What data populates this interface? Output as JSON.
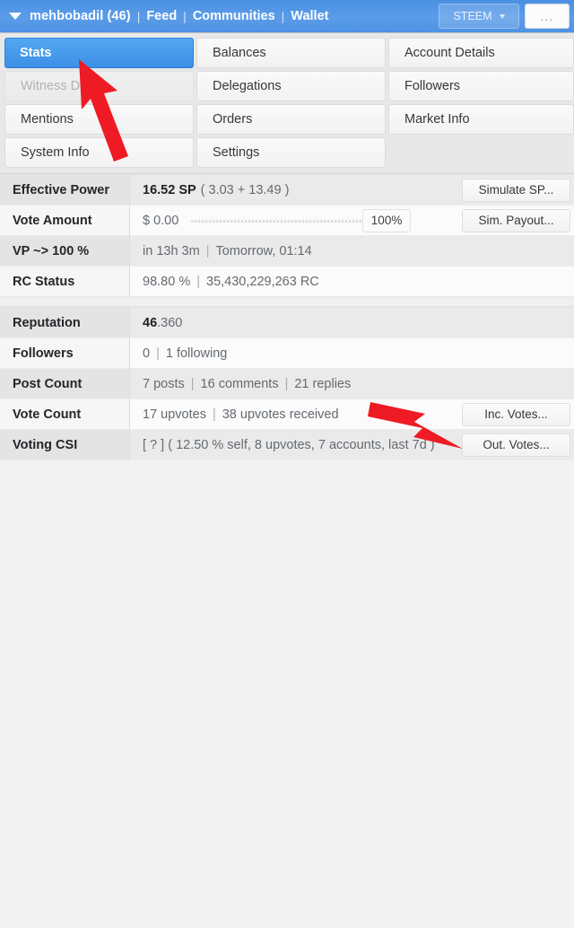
{
  "header": {
    "caret_icon": "caret-down-icon",
    "account": "mehbobadil (46)",
    "sep": "|",
    "links": [
      "Feed",
      "Communities",
      "Wallet"
    ],
    "token_selector": "STEEM",
    "token_caret_icon": "chevron-down-icon",
    "overflow_label": "...",
    "bg_color": "#4a90e2"
  },
  "nav": {
    "buttons": [
      {
        "label": "Stats",
        "state": "active"
      },
      {
        "label": "Balances",
        "state": "normal"
      },
      {
        "label": "Account Details",
        "state": "normal"
      },
      {
        "label": "Witness Detail",
        "state": "disabled"
      },
      {
        "label": "Delegations",
        "state": "normal"
      },
      {
        "label": "Followers",
        "state": "normal"
      },
      {
        "label": "Mentions",
        "state": "normal"
      },
      {
        "label": "Orders",
        "state": "normal"
      },
      {
        "label": "Market Info",
        "state": "normal"
      },
      {
        "label": "System Info",
        "state": "normal"
      },
      {
        "label": "Settings",
        "state": "normal"
      },
      {
        "label": "",
        "state": "empty"
      }
    ],
    "active_color": "#3d8fe6"
  },
  "stats": {
    "group1": [
      {
        "label": "Effective Power",
        "value_strong": "16.52 SP",
        "value_muted": "( 3.03 + 13.49 )",
        "button": "Simulate SP..."
      },
      {
        "label": "Vote Amount",
        "value_strong": "$ 0.00",
        "slider_value": "100%",
        "button": "Sim. Payout..."
      },
      {
        "label": "VP ~> 100 %",
        "part1": "in 13h 3m",
        "sep": "|",
        "part2": "Tomorrow, 01:14"
      },
      {
        "label": "RC Status",
        "part1": "98.80 %",
        "sep": "|",
        "part2": "35,430,229,263 RC"
      }
    ],
    "group2": [
      {
        "label": "Reputation",
        "value_strong": "46",
        "value_muted": ".360"
      },
      {
        "label": "Followers",
        "part1": "0",
        "sep": "|",
        "part2": "1 following"
      },
      {
        "label": "Post Count",
        "part1": "7 posts",
        "sep": "|",
        "part2": "16 comments",
        "sep2": "|",
        "part3": "21 replies"
      },
      {
        "label": "Vote Count",
        "part1": "17 upvotes",
        "sep": "|",
        "part2": "38 upvotes received",
        "button": "Inc. Votes..."
      },
      {
        "label": "Voting CSI",
        "value_plain": "[ ? ] ( 12.50 % self, 8 upvotes, 7 accounts, last 7d )",
        "button": "Out. Votes..."
      }
    ]
  },
  "annotations": {
    "arrow_color": "#ef1b24",
    "arrow_1_target": "Stats",
    "arrow_2_target": "Out. Votes..."
  }
}
